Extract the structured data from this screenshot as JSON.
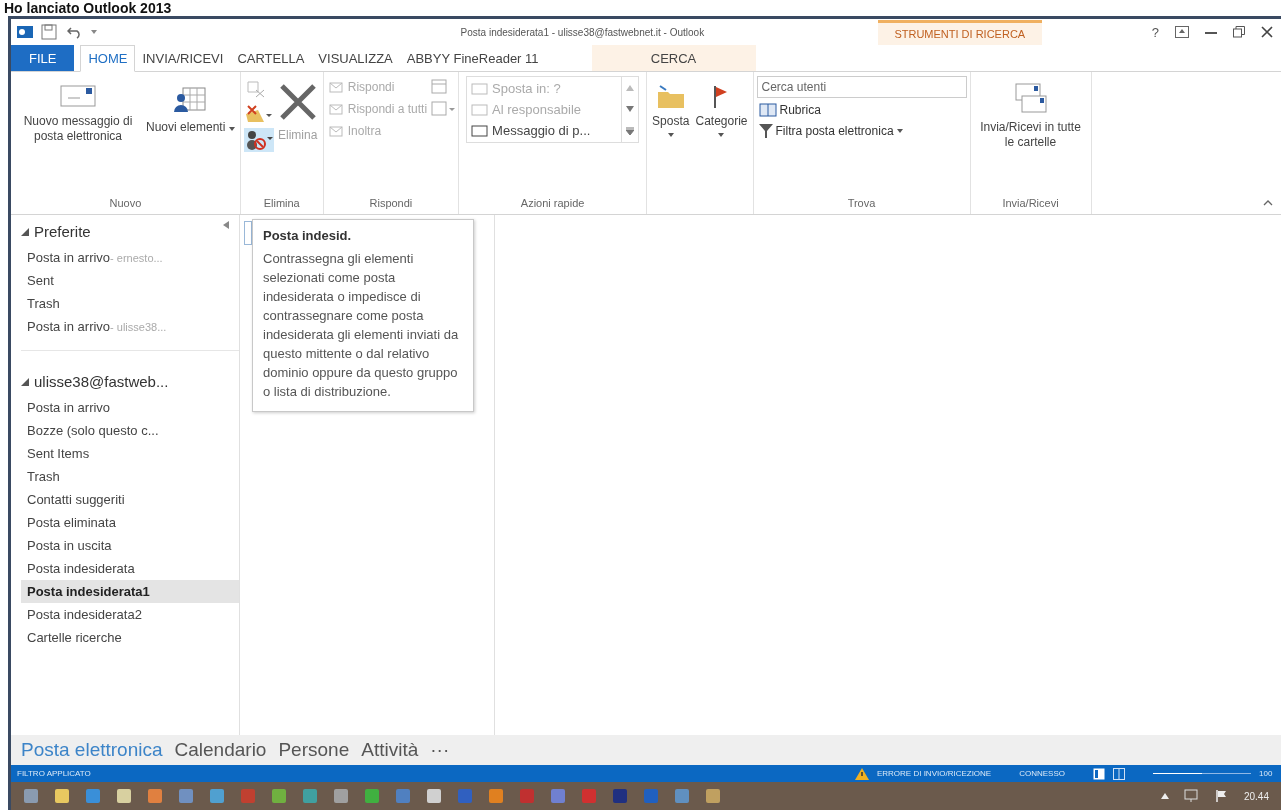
{
  "heading": "Ho lanciato Outlook 2013",
  "window": {
    "title": "Posta indesiderata1 - ulisse38@fastwebnet.it - Outlook",
    "context_group": "STRUMENTI DI RICERCA",
    "help": "?"
  },
  "tabs": [
    {
      "label": "FILE",
      "kind": "file",
      "selected": false
    },
    {
      "label": "HOME",
      "kind": "tab",
      "selected": true
    },
    {
      "label": "INVIA/RICEVI",
      "kind": "tab",
      "selected": false
    },
    {
      "label": "CARTELLA",
      "kind": "tab",
      "selected": false
    },
    {
      "label": "VISUALIZZA",
      "kind": "tab",
      "selected": false
    },
    {
      "label": "ABBYY FineReader 11",
      "kind": "tab",
      "selected": false
    },
    {
      "label": "CERCA",
      "kind": "context",
      "selected": false
    }
  ],
  "ribbon": {
    "nuovo": {
      "label": "Nuovo",
      "new_email": "Nuovo messaggio di posta elettronica",
      "new_items": "Nuovi elementi"
    },
    "elimina": {
      "label": "Elimina",
      "delete": {
        "label": "Elimina",
        "disabled": true
      }
    },
    "rispondi": {
      "label": "Rispondi",
      "buttons": [
        {
          "label": "Rispondi",
          "disabled": true
        },
        {
          "label": "Rispondi a tutti",
          "disabled": true
        },
        {
          "label": "Inoltra",
          "disabled": true
        }
      ]
    },
    "azioni_rapide": {
      "label": "Azioni rapide",
      "steps": [
        {
          "label": "Sposta in: ?",
          "disabled": true
        },
        {
          "label": "Al responsabile",
          "disabled": true
        },
        {
          "label": "Messaggio di p...",
          "disabled": false
        }
      ]
    },
    "sposta": {
      "label": "Sposta"
    },
    "categorie": {
      "label": "Categorie"
    },
    "trova": {
      "label": "Trova",
      "search": {
        "placeholder": "Cerca utenti"
      },
      "address_book": "Rubrica",
      "filter": "Filtra posta elettronica"
    },
    "invia_ricevi": {
      "label": "Invia/Ricevi",
      "send_all": "Invia/Ricevi in tutte le cartelle"
    }
  },
  "folders": [
    {
      "name": "Preferite",
      "expanded": true,
      "children": [
        {
          "name": "Posta in arrivo",
          "suffix": "- ernesto...",
          "selected": false
        },
        {
          "name": "Sent",
          "selected": false
        },
        {
          "name": "Trash",
          "selected": false
        },
        {
          "name": "Posta in arrivo",
          "suffix": "- ulisse38...",
          "selected": false
        }
      ]
    },
    {
      "name": "ulisse38@fastweb...",
      "expanded": true,
      "children": [
        {
          "name": "Posta in arrivo",
          "selected": false
        },
        {
          "name": "Bozze (solo questo c...",
          "selected": false
        },
        {
          "name": "Sent Items",
          "selected": false
        },
        {
          "name": "Trash",
          "selected": false
        },
        {
          "name": "Contatti suggeriti",
          "selected": false
        },
        {
          "name": "Posta eliminata",
          "selected": false
        },
        {
          "name": "Posta in uscita",
          "selected": false
        },
        {
          "name": "Posta indesiderata",
          "selected": false
        },
        {
          "name": "Posta indesiderata1",
          "selected": true
        },
        {
          "name": "Posta indesiderata2",
          "selected": false
        },
        {
          "name": "Cartelle ricerche",
          "selected": false
        }
      ]
    }
  ],
  "tooltip": {
    "title": "Posta indesid.",
    "body": "Contrassegna gli elementi selezionati come posta indesiderata o impedisce di contrassegnare come posta indesiderata gli elementi inviati da questo mittente o dal relativo dominio oppure da questo gruppo o lista di distribuzione."
  },
  "nav": [
    {
      "label": "Posta elettronica",
      "selected": true
    },
    {
      "label": "Calendario",
      "selected": false
    },
    {
      "label": "Persone",
      "selected": false
    },
    {
      "label": "Attività",
      "selected": false
    },
    {
      "label": "···",
      "selected": false
    }
  ],
  "status_bar": {
    "filter": "FILTRO APPLICATO",
    "error": "ERRORE DI INVIO/RICEZIONE",
    "connection": "CONNESSO",
    "zoom": {
      "level": 0.5,
      "text": "100"
    }
  },
  "taskbar": {
    "clock": "20.44"
  }
}
